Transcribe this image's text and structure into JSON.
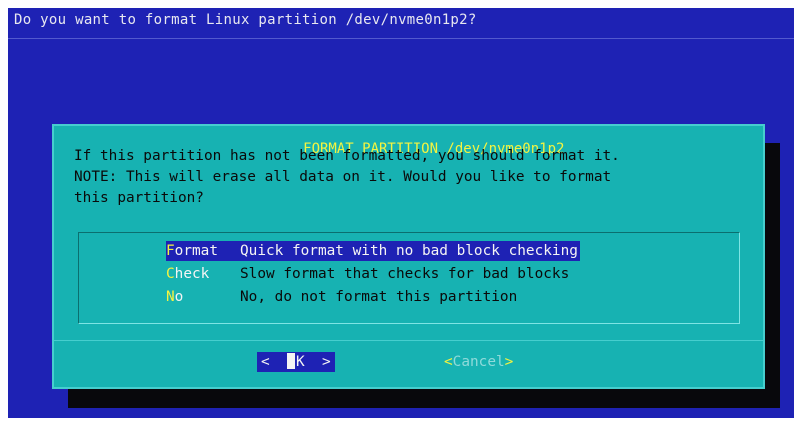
{
  "backtitle": "Do you want to format Linux partition /dev/nvme0n1p2?",
  "dialog": {
    "title": "FORMAT PARTITION /dev/nvme0n1p2",
    "message_lines": [
      "If this partition has not been formatted, you should format it.",
      "NOTE: This will erase all data on it. Would you like to format",
      "this partition?"
    ],
    "menu": [
      {
        "hotkey": "F",
        "rest": "ormat",
        "description": "Quick format with no bad block checking",
        "selected": true
      },
      {
        "hotkey": "C",
        "rest": "heck",
        "description": "Slow format that checks for bad blocks",
        "selected": false
      },
      {
        "hotkey": "N",
        "rest": "o",
        "description": "No, do not format this partition",
        "selected": false
      }
    ],
    "buttons": {
      "ok_left": "<",
      "ok_label": "K",
      "ok_right": ">",
      "cancel_left": "<",
      "cancel_label": "Cancel",
      "cancel_right": ">"
    }
  },
  "colors": {
    "background": "#1e22b4",
    "dialog": "#17b2b2",
    "highlight": "#1e22b4",
    "hotkey": "#f4f440"
  }
}
